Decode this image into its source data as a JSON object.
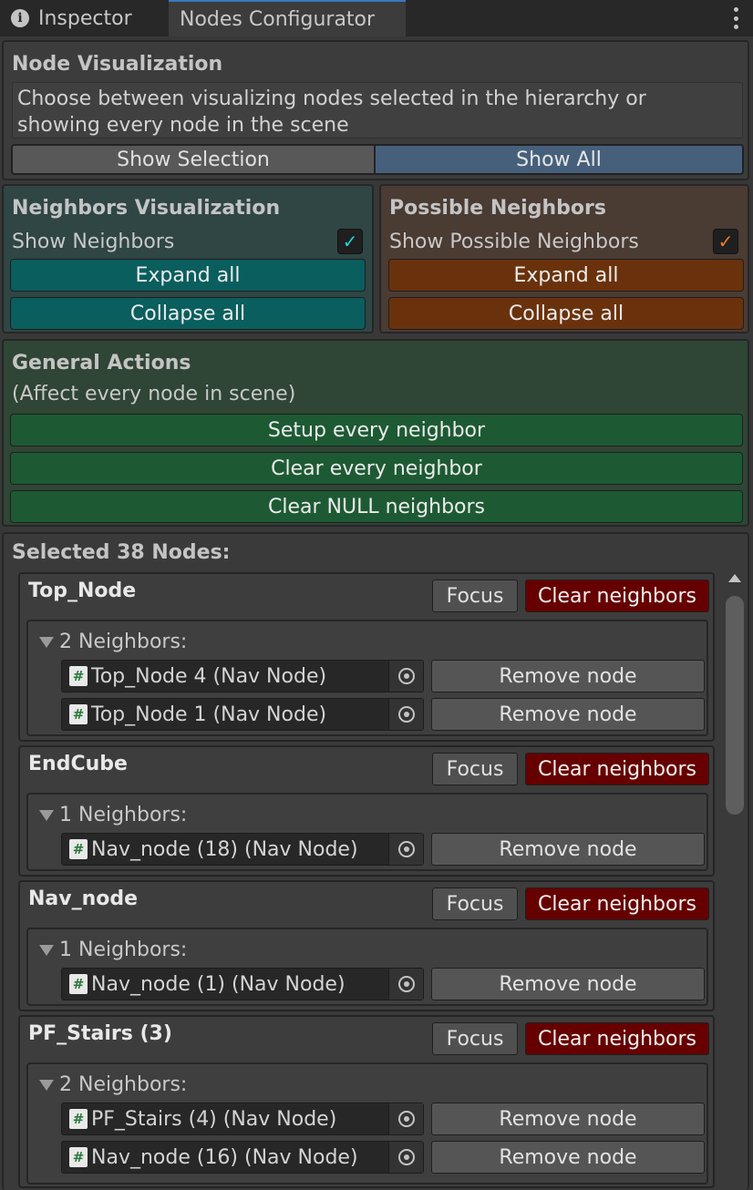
{
  "tabs": [
    {
      "label": "Inspector",
      "icon": "info-icon",
      "active": false
    },
    {
      "label": "Nodes Configurator",
      "active": true
    }
  ],
  "node_visualization": {
    "title": "Node Visualization",
    "help_line1": "Choose between visualizing nodes selected in the hierarchy or",
    "help_line2": "showing every node in the scene",
    "show_selection": "Show Selection",
    "show_all": "Show All",
    "selected_mode": "Show All"
  },
  "neighbors_visualization": {
    "title": "Neighbors Visualization",
    "toggle_label": "Show Neighbors",
    "toggle_checked": true,
    "expand": "Expand all",
    "collapse": "Collapse all",
    "color": "#0a5e5e"
  },
  "possible_neighbors": {
    "title": "Possible Neighbors",
    "toggle_label": "Show Possible Neighbors",
    "toggle_checked": true,
    "expand": "Expand all",
    "collapse": "Collapse all",
    "color": "#6a320c"
  },
  "general_actions": {
    "title": "General Actions",
    "note": "(Affect every node in scene)",
    "setup": "Setup every neighbor",
    "clear": "Clear every neighbor",
    "clear_null": "Clear NULL neighbors"
  },
  "selected": {
    "title": "Selected 38 Nodes:",
    "focus_label": "Focus",
    "clear_label": "Clear neighbors",
    "remove_label": "Remove node",
    "nodes": [
      {
        "name": "Top_Node",
        "neighbors_label": "2 Neighbors:",
        "neighbors": [
          "Top_Node 4 (Nav Node)",
          "Top_Node 1 (Nav Node)"
        ]
      },
      {
        "name": "EndCube",
        "neighbors_label": "1 Neighbors:",
        "neighbors": [
          "Nav_node (18) (Nav Node)"
        ]
      },
      {
        "name": "Nav_node",
        "neighbors_label": "1 Neighbors:",
        "neighbors": [
          "Nav_node (1) (Nav Node)"
        ]
      },
      {
        "name": "PF_Stairs (3)",
        "neighbors_label": "2 Neighbors:",
        "neighbors": [
          "PF_Stairs (4) (Nav Node)",
          "Nav_node (16) (Nav Node)"
        ]
      }
    ]
  }
}
